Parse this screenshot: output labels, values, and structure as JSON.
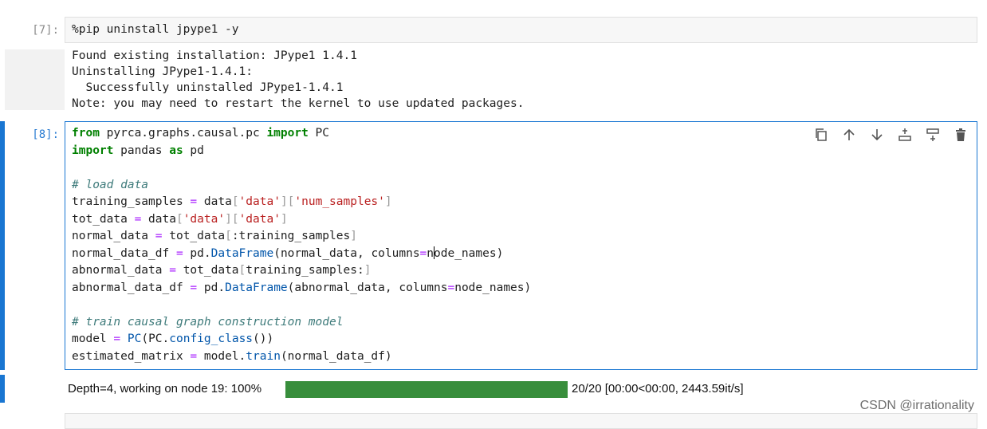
{
  "cell7": {
    "prompt": "[7]:",
    "code": "%pip uninstall jpype1 -y",
    "output_lines": [
      "Found existing installation: JPype1 1.4.1",
      "Uninstalling JPype1-1.4.1:",
      "  Successfully uninstalled JPype1-1.4.1",
      "Note: you may need to restart the kernel to use updated packages."
    ]
  },
  "cell8": {
    "prompt": "[8]:",
    "toolbar": [
      "duplicate-icon",
      "move-up-icon",
      "move-down-icon",
      "insert-above-icon",
      "insert-below-icon",
      "delete-icon"
    ],
    "code": {
      "line1": {
        "kw1": "from",
        "mod": " pyrca.graphs.causal.pc ",
        "kw2": "import",
        "name": " PC"
      },
      "line2": {
        "kw1": "import",
        "mod": " pandas ",
        "kw2": "as",
        "name": " pd"
      },
      "comment1": "# load data",
      "comment2": "# train causal graph construction model",
      "training_samples": "training_samples",
      "data": "data",
      "data_key": "'data'",
      "num_samples_key": "'num_samples'",
      "tot_data": "tot_data",
      "normal_data": "normal_data",
      "normal_data_df": "normal_data_df",
      "abnormal_data": "abnormal_data",
      "abnormal_data_df": "abnormal_data_df",
      "pd": "pd",
      "DataFrame": "DataFrame",
      "columns": "columns",
      "node_names_a": "n",
      "node_names_b": "ode_names",
      "node_names": "node_names",
      "model": "model",
      "PC": "PC",
      "config_class": "config_class",
      "estimated_matrix": "estimated_matrix",
      "train": "train"
    },
    "progress": {
      "label": "Depth=4, working on node 19: 100%",
      "fraction": 1.0,
      "stats": "20/20 [00:00<00:00, 2443.59it/s]",
      "color": "#388e3c"
    }
  },
  "watermark": "CSDN @irrationality"
}
